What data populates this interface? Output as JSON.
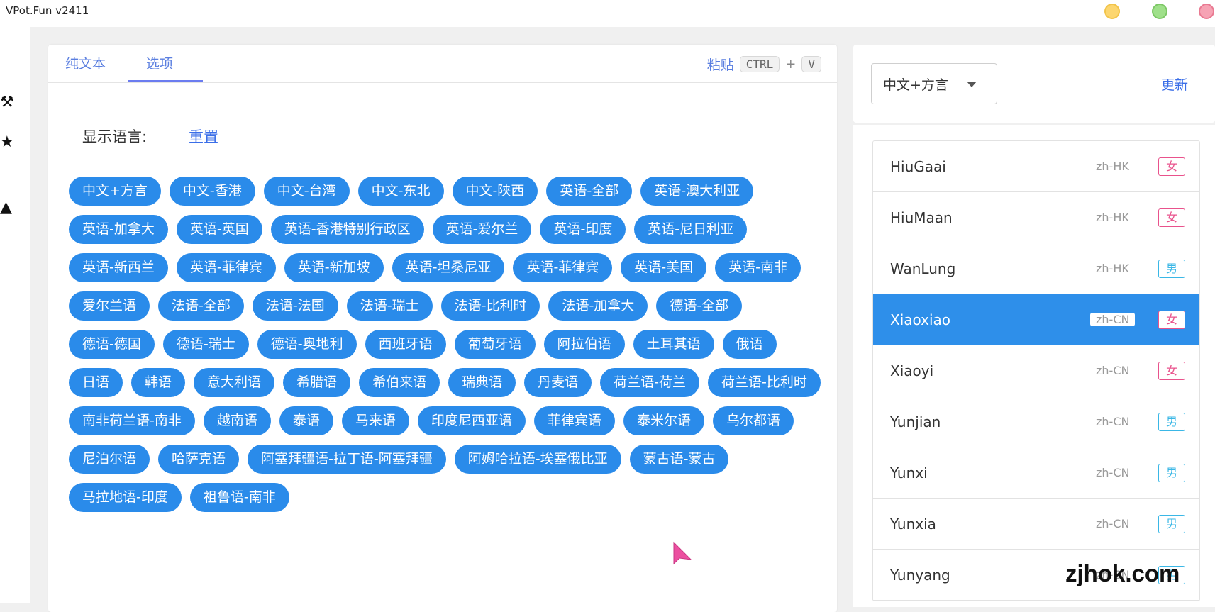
{
  "app": {
    "title": "VPot.Fun v2411"
  },
  "tabs": [
    {
      "label": "纯文本"
    },
    {
      "label": "选项"
    }
  ],
  "paste": {
    "label": "粘贴",
    "key1": "CTRL",
    "plus": "+",
    "key2": "V"
  },
  "options": {
    "display_language_label": "显示语言:",
    "reset_label": "重置",
    "languages": [
      "中文+方言",
      "中文-香港",
      "中文-台湾",
      "中文-东北",
      "中文-陕西",
      "英语-全部",
      "英语-澳大利亚",
      "英语-加拿大",
      "英语-英国",
      "英语-香港特别行政区",
      "英语-爱尔兰",
      "英语-印度",
      "英语-尼日利亚",
      "英语-新西兰",
      "英语-菲律宾",
      "英语-新加坡",
      "英语-坦桑尼亚",
      "英语-菲律宾",
      "英语-美国",
      "英语-南非",
      "爱尔兰语",
      "法语-全部",
      "法语-法国",
      "法语-瑞士",
      "法语-比利时",
      "法语-加拿大",
      "德语-全部",
      "德语-德国",
      "德语-瑞士",
      "德语-奥地利",
      "西班牙语",
      "葡萄牙语",
      "阿拉伯语",
      "土耳其语",
      "俄语",
      "日语",
      "韩语",
      "意大利语",
      "希腊语",
      "希伯来语",
      "瑞典语",
      "丹麦语",
      "荷兰语-荷兰",
      "荷兰语-比利时",
      "南非荷兰语-南非",
      "越南语",
      "泰语",
      "马来语",
      "印度尼西亚语",
      "菲律宾语",
      "泰米尔语",
      "乌尔都语",
      "尼泊尔语",
      "哈萨克语",
      "阿塞拜疆语-拉丁语-阿塞拜疆",
      "阿姆哈拉语-埃塞俄比亚",
      "蒙古语-蒙古",
      "马拉地语-印度",
      "祖鲁语-南非"
    ]
  },
  "voice_panel": {
    "selected_language": "中文+方言",
    "refresh_label": "更新",
    "voices": [
      {
        "name": "HiuGaai",
        "locale": "zh-HK",
        "gender": "女"
      },
      {
        "name": "HiuMaan",
        "locale": "zh-HK",
        "gender": "女"
      },
      {
        "name": "WanLung",
        "locale": "zh-HK",
        "gender": "男"
      },
      {
        "name": "Xiaoxiao",
        "locale": "zh-CN",
        "gender": "女",
        "selected": true
      },
      {
        "name": "Xiaoyi",
        "locale": "zh-CN",
        "gender": "女"
      },
      {
        "name": "Yunjian",
        "locale": "zh-CN",
        "gender": "男"
      },
      {
        "name": "Yunxi",
        "locale": "zh-CN",
        "gender": "男"
      },
      {
        "name": "Yunxia",
        "locale": "zh-CN",
        "gender": "男"
      },
      {
        "name": "Yunyang",
        "locale": "zh-CN",
        "gender": "男"
      }
    ]
  },
  "watermark": "zjhok.com",
  "colors": {
    "accent": "#2a8bea",
    "female": "#e9528c",
    "male": "#3ab7e6"
  }
}
